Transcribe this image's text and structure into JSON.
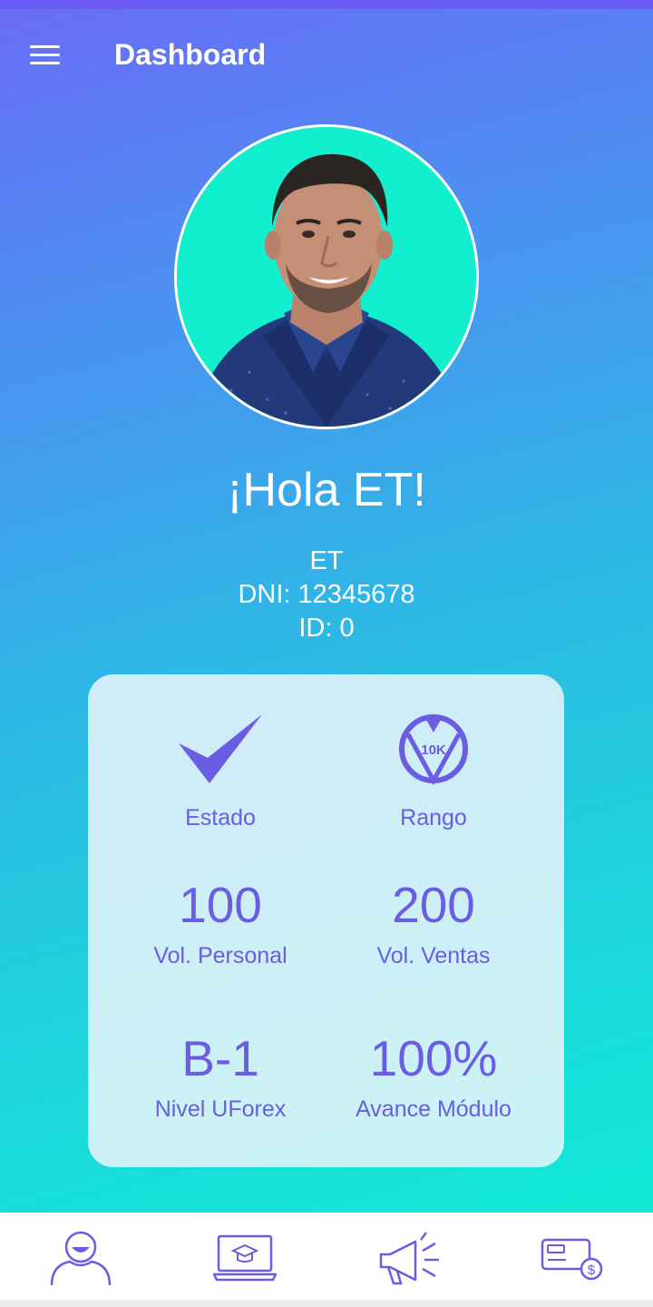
{
  "app_bar": {
    "title": "Dashboard",
    "menu_icon": "hamburger-menu-icon"
  },
  "profile": {
    "greeting": "¡Hola ET!",
    "name": "ET",
    "dni": "DNI: 12345678",
    "id": "ID: 0"
  },
  "stats": {
    "estado": {
      "label": "Estado",
      "icon": "checkmark-icon"
    },
    "rango": {
      "label": "Rango",
      "icon": "rank-10k-badge-icon",
      "badge_text": "10K"
    },
    "vol_personal": {
      "value": "100",
      "label": "Vol. Personal"
    },
    "vol_ventas": {
      "value": "200",
      "label": "Vol. Ventas"
    },
    "nivel": {
      "value": "B-1",
      "label": "Nivel UForex"
    },
    "avance": {
      "value": "100%",
      "label": "Avance Módulo"
    }
  },
  "bottom_nav": [
    {
      "icon": "user-profile-icon"
    },
    {
      "icon": "laptop-graduation-icon"
    },
    {
      "icon": "megaphone-icon"
    },
    {
      "icon": "card-payment-icon"
    }
  ],
  "colors": {
    "accent": "#6a5ce3",
    "gradient_top": "#6a6cf7",
    "gradient_bottom": "#12ead6"
  }
}
